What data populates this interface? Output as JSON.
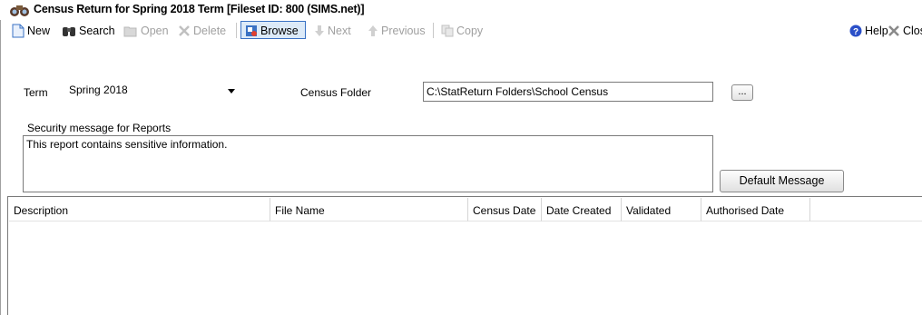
{
  "window": {
    "title": "Census Return for Spring 2018 Term [Fileset ID:  800 (SIMS.net)]"
  },
  "toolbar": {
    "new_label": "New",
    "search_label": "Search",
    "open_label": "Open",
    "delete_label": "Delete",
    "browse_label": "Browse",
    "next_label": "Next",
    "previous_label": "Previous",
    "copy_label": "Copy",
    "help_label": "Help",
    "close_label": "Close"
  },
  "form": {
    "term_label": "Term",
    "term_value": "Spring 2018",
    "census_folder_label": "Census Folder",
    "census_folder_value": "C:\\StatReturn Folders\\School Census",
    "browse_button_label": "...",
    "security_label": "Security message for Reports",
    "security_message": "This report contains sensitive information.",
    "default_message_button": "Default Message"
  },
  "grid": {
    "columns": [
      "Description",
      "File Name",
      "Census Date",
      "Date Created",
      "Validated",
      "Authorised Date"
    ]
  },
  "colors": {
    "accent": "#3a72c4",
    "disabled_text": "#a0a0a0"
  }
}
